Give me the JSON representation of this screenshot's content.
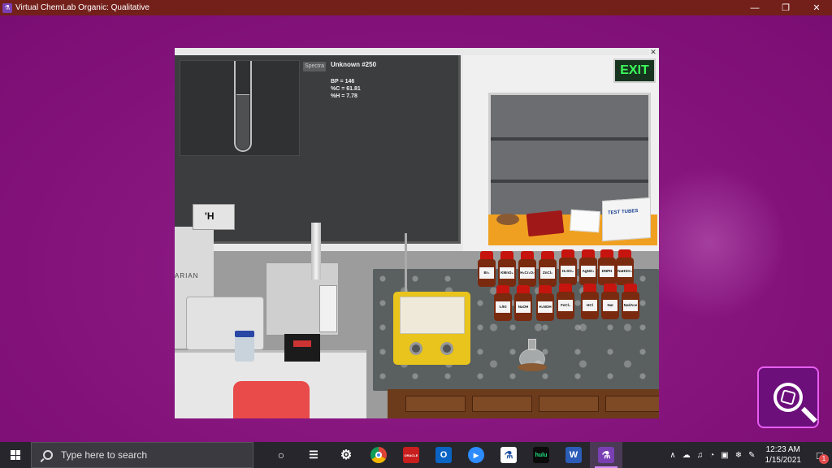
{
  "window": {
    "title": "Virtual ChemLab Organic: Qualitative",
    "minimize_glyph": "—",
    "restore_glyph": "❐",
    "close_glyph": "✕"
  },
  "lab": {
    "close_glyph": "✕",
    "spectra_label": "Spectra",
    "unknown_title": "Unknown #250",
    "properties": [
      "BP = 146",
      "%C = 61.81",
      "%H = 7.78"
    ],
    "exit_sign": "EXIT",
    "gauge_reading": "'H",
    "varian_logo": "ARIAN",
    "test_tubes_label": "TEST TUBES",
    "reagents_row1": [
      "Br₂",
      "KMnO₄",
      "H₂Cr₂O₇",
      "ZnCl₂",
      "H₂SO₄",
      "AgNO₃",
      "DNPH",
      "NaHSO₃"
    ],
    "reagents_row2": [
      "I₂/KI",
      "NaOH",
      "H₂NOH",
      "FeCl₃",
      "HCl",
      "NaI",
      "NaI/Ace"
    ]
  },
  "taskbar": {
    "search_placeholder": "Type here to search",
    "apps": [
      {
        "name": "task-view-icon",
        "glyph": "○"
      },
      {
        "name": "multitask-icon",
        "glyph": "☰"
      },
      {
        "name": "settings-icon",
        "glyph": "⚙"
      },
      {
        "name": "chrome-icon",
        "glyph": ""
      },
      {
        "name": "oracle-icon",
        "glyph": "ORACLE"
      },
      {
        "name": "outlook-icon",
        "glyph": "O"
      },
      {
        "name": "zoom-icon",
        "glyph": "▶"
      },
      {
        "name": "chemlab-icon",
        "glyph": "⚗"
      },
      {
        "name": "hulu-icon",
        "glyph": "hulu"
      },
      {
        "name": "word-icon",
        "glyph": "W"
      },
      {
        "name": "chemlab-active-icon",
        "glyph": "⚗"
      }
    ],
    "tray_glyphs": [
      "∧",
      "☁",
      "♫",
      "◔",
      "▣",
      "❄",
      "✎"
    ],
    "time": "12:23 AM",
    "date": "1/15/2021",
    "notification_count": "1"
  },
  "colors": {
    "desktop": "#86117f",
    "titlebar": "#73201b",
    "taskbar": "#27262c",
    "accent": "#e65ef0"
  }
}
